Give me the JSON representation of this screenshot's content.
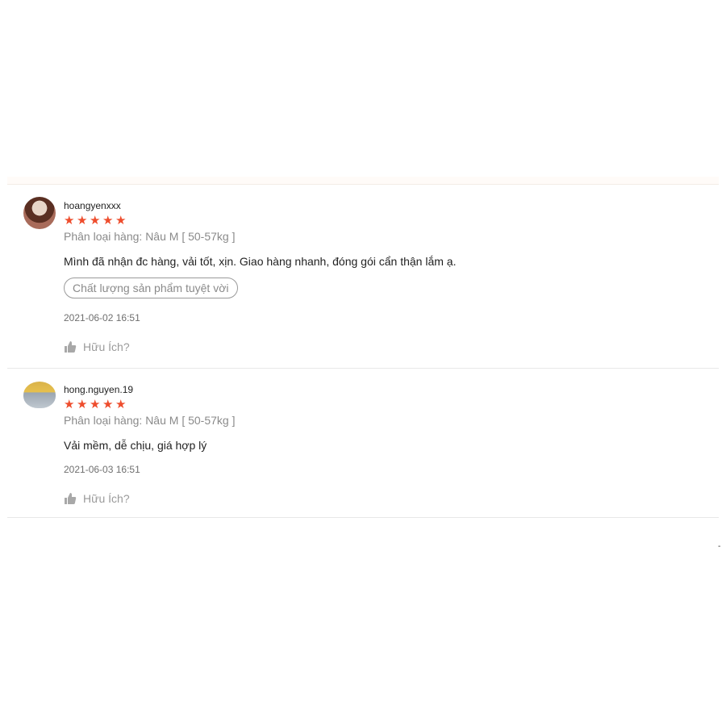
{
  "reviews": [
    {
      "username": "hoangyenxxx",
      "stars": "★★★★★",
      "variant": "Phân loại hàng: Nâu M [ 50-57kg ]",
      "comment": "Mình đã nhận đc hàng, vải tốt, xịn. Giao hàng nhanh, đóng gói cẩn thận lắm ạ.",
      "tag": "Chất lượng sản phẩm tuyệt vời",
      "time": "2021-06-02 16:51",
      "helpful": "Hữu Ích?"
    },
    {
      "username": "hong.nguyen.19",
      "stars": "★★★★★",
      "variant": "Phân loại hàng: Nâu M [ 50-57kg ]",
      "comment": "Vải mềm, dễ chịu, giá hợp lý",
      "time": "2021-06-03 16:51",
      "helpful": "Hữu Ích?"
    }
  ],
  "colors": {
    "star": "#ee4d2d",
    "muted": "#8a8a8a",
    "divider": "#e8e8e8"
  }
}
